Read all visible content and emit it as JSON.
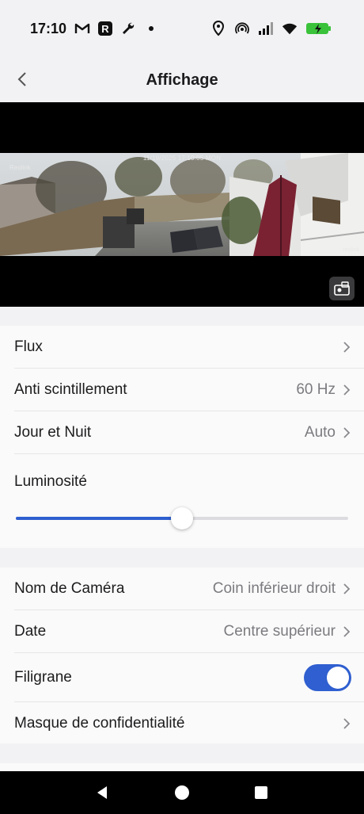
{
  "status_bar": {
    "time": "17:10",
    "left_icons": [
      "gmail-icon",
      "app-r-icon",
      "wrench-icon",
      "dot-icon"
    ],
    "right_icons": [
      "location-icon",
      "hotspot-icon",
      "signal-icon",
      "wifi-icon",
      "battery-charging-icon"
    ]
  },
  "header": {
    "title": "Affichage",
    "back_icon": "chevron-left-icon"
  },
  "video": {
    "osd_timestamp": "11/19/2025 17:10:05 MON",
    "osd_name": "Reolink",
    "osd_watermark": "reolink",
    "snapshot_icon": "snapshot-icon"
  },
  "settings_group_1": {
    "rows": [
      {
        "label": "Flux",
        "value": ""
      },
      {
        "label": "Anti scintillement",
        "value": "60 Hz"
      },
      {
        "label": "Jour et Nuit",
        "value": "Auto"
      }
    ],
    "brightness": {
      "label": "Luminosité",
      "value_fraction": 0.5
    }
  },
  "settings_group_2": {
    "rows": [
      {
        "label": "Nom de Caméra",
        "value": "Coin inférieur droit"
      },
      {
        "label": "Date",
        "value": "Centre supérieur"
      }
    ],
    "watermark": {
      "label": "Filigrane",
      "enabled": true
    },
    "privacy": {
      "label": "Masque de confidentialité",
      "value": ""
    }
  },
  "colors": {
    "accent": "#2f5fd0",
    "background": "#f2f2f4",
    "row_bg": "#fafafa"
  },
  "nav_bar": [
    "back-triangle-icon",
    "home-circle-icon",
    "recents-square-icon"
  ]
}
